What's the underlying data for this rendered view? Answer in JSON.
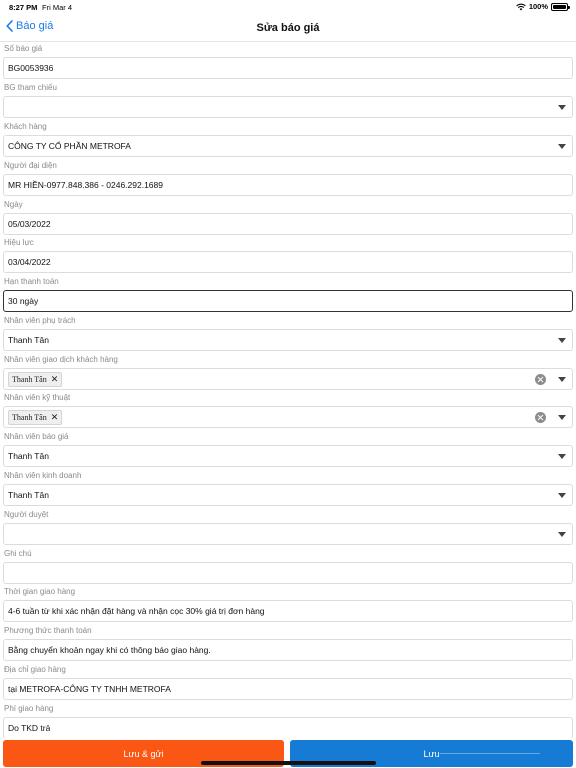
{
  "status_bar": {
    "time": "8:27 PM",
    "date": "Fri Mar 4",
    "battery": "100%"
  },
  "nav": {
    "back_label": "Báo giá",
    "title": "Sửa báo giá"
  },
  "fields": [
    {
      "label": "Số báo giá",
      "value": "BG0053936",
      "type": "text"
    },
    {
      "label": "BG tham chiếu",
      "value": "",
      "type": "select"
    },
    {
      "label": "Khách hàng",
      "value": "CÔNG TY CỔ PHẦN METROFA",
      "type": "select"
    },
    {
      "label": "Người đại diện",
      "value": "MR HIỀN-0977.848.386 - 0246.292.1689",
      "type": "text"
    },
    {
      "label": "Ngày",
      "value": "05/03/2022",
      "type": "text"
    },
    {
      "label": "Hiệu lực",
      "value": "03/04/2022",
      "type": "text"
    },
    {
      "label": "Hạn thanh toán",
      "value": "30 ngày",
      "type": "text",
      "focused": true
    },
    {
      "label": "Nhân viên phụ trách",
      "value": "Thanh Tân",
      "type": "select"
    },
    {
      "label": "Nhân viên giao dịch khách hàng",
      "chip": "Thanh Tân",
      "type": "multiselect"
    },
    {
      "label": "Nhân viên kỹ thuật",
      "chip": "Thanh Tân",
      "type": "multiselect"
    },
    {
      "label": "Nhân viên báo giá",
      "value": "Thanh Tân",
      "type": "select"
    },
    {
      "label": "Nhân viên kinh doanh",
      "value": "Thanh Tân",
      "type": "select"
    },
    {
      "label": "Người duyệt",
      "value": "",
      "type": "select"
    },
    {
      "label": "Ghi chú",
      "value": "",
      "type": "text"
    },
    {
      "label": "Thời gian giao hàng",
      "value": "4-6 tuần từ khi xác nhận đặt hàng và nhận cọc 30% giá trị đơn hàng",
      "type": "text"
    },
    {
      "label": "Phương thức thanh toán",
      "value": "Bằng chuyển khoản ngay khi có thông báo giao hàng.",
      "type": "text"
    },
    {
      "label": "Địa chỉ giao hàng",
      "value": "tại METROFA-CÔNG TY TNHH METROFA",
      "type": "text"
    },
    {
      "label": "Phí giao hàng",
      "value": "Do TKD trả",
      "type": "text"
    }
  ],
  "chip_remove_symbol": "✕",
  "buttons": {
    "save_send": "Lưu & gửi",
    "save": "Lưu"
  },
  "colors": {
    "accent_blue": "#1a7ae8",
    "save_send_bg": "#fb5714",
    "save_bg": "#157bd4"
  }
}
